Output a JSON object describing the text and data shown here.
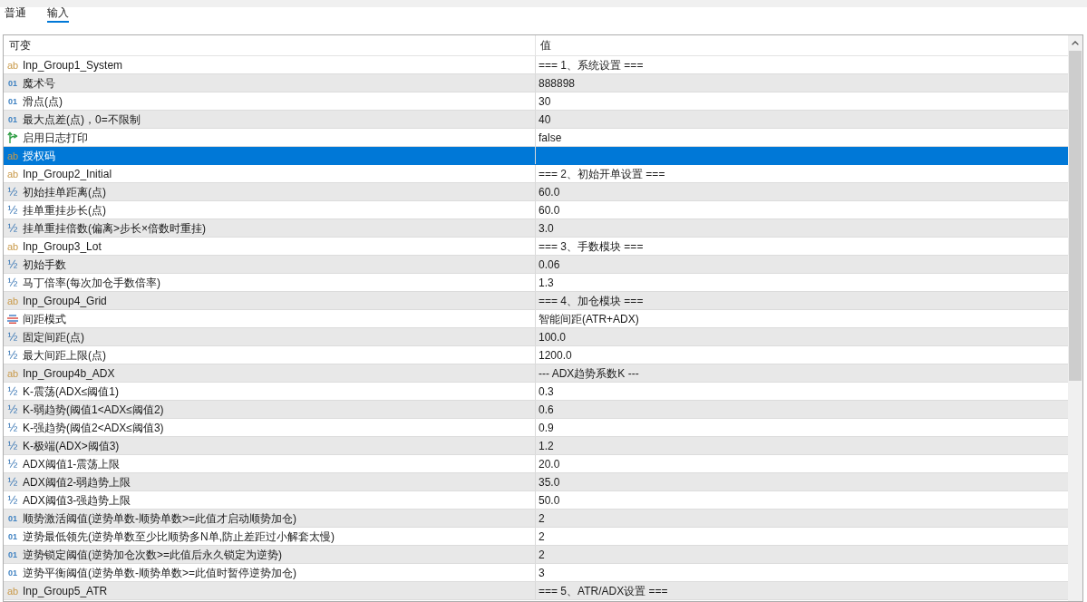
{
  "tabs": [
    {
      "label": "普通",
      "selected": false
    },
    {
      "label": "输入",
      "selected": true
    }
  ],
  "table": {
    "columns": [
      "可变",
      "值"
    ],
    "rows": [
      {
        "kind": "string",
        "type_icon": "ab",
        "name": "Inp_Group1_System",
        "value": "=== 1、系统设置 ===",
        "selected": false
      },
      {
        "kind": "integer",
        "type_icon": "01",
        "name": "魔术号",
        "value": "888898",
        "selected": false
      },
      {
        "kind": "integer",
        "type_icon": "01",
        "name": "滑点(点)",
        "value": "30",
        "selected": false
      },
      {
        "kind": "integer",
        "type_icon": "01",
        "name": "最大点差(点)，0=不限制",
        "value": "40",
        "selected": false
      },
      {
        "kind": "bool",
        "name": "启用日志打印",
        "value": "false",
        "selected": false
      },
      {
        "kind": "string",
        "type_icon": "ab",
        "name": "授权码",
        "selected": true
      },
      {
        "kind": "string",
        "type_icon": "ab",
        "name": "Inp_Group2_Initial",
        "value": "=== 2、初始开单设置 ===",
        "selected": false
      },
      {
        "kind": "double",
        "type_icon": "½",
        "name": "初始挂单距离(点)",
        "value": "60.0",
        "selected": false
      },
      {
        "kind": "double",
        "type_icon": "½",
        "name": "挂单重挂步长(点)",
        "value": "60.0",
        "selected": false
      },
      {
        "kind": "double",
        "type_icon": "½",
        "name": "挂单重挂倍数(偏离>步长×倍数时重挂)",
        "value": "3.0",
        "selected": false
      },
      {
        "kind": "string",
        "type_icon": "ab",
        "name": "Inp_Group3_Lot",
        "value": "=== 3、手数模块 ===",
        "selected": false
      },
      {
        "kind": "double",
        "type_icon": "½",
        "name": "初始手数",
        "value": "0.06",
        "selected": false
      },
      {
        "kind": "double",
        "type_icon": "½",
        "name": "马丁倍率(每次加仓手数倍率)",
        "value": "1.3",
        "selected": false
      },
      {
        "kind": "string",
        "type_icon": "ab",
        "name": "Inp_Group4_Grid",
        "value": "=== 4、加仓模块 ===",
        "selected": false
      },
      {
        "kind": "enum",
        "name": "间距模式",
        "value": "智能间距(ATR+ADX)",
        "selected": false
      },
      {
        "kind": "double",
        "type_icon": "½",
        "name": "固定间距(点)",
        "value": "100.0",
        "selected": false
      },
      {
        "kind": "double",
        "type_icon": "½",
        "name": "最大间距上限(点)",
        "value": "1200.0",
        "selected": false
      },
      {
        "kind": "string",
        "type_icon": "ab",
        "name": "Inp_Group4b_ADX",
        "value": "--- ADX趋势系数K ---",
        "selected": false
      },
      {
        "kind": "double",
        "type_icon": "½",
        "name": "K-震荡(ADX≤阈值1)",
        "value": "0.3",
        "selected": false
      },
      {
        "kind": "double",
        "type_icon": "½",
        "name": "K-弱趋势(阈值1<ADX≤阈值2)",
        "value": "0.6",
        "selected": false
      },
      {
        "kind": "double",
        "type_icon": "½",
        "name": "K-强趋势(阈值2<ADX≤阈值3)",
        "value": "0.9",
        "selected": false
      },
      {
        "kind": "double",
        "type_icon": "½",
        "name": "K-极端(ADX>阈值3)",
        "value": "1.2",
        "selected": false
      },
      {
        "kind": "double",
        "type_icon": "½",
        "name": "ADX阈值1-震荡上限",
        "value": "20.0",
        "selected": false
      },
      {
        "kind": "double",
        "type_icon": "½",
        "name": "ADX阈值2-弱趋势上限",
        "value": "35.0",
        "selected": false
      },
      {
        "kind": "double",
        "type_icon": "½",
        "name": "ADX阈值3-强趋势上限",
        "value": "50.0",
        "selected": false
      },
      {
        "kind": "integer",
        "type_icon": "01",
        "name": "顺势激活阈值(逆势单数-顺势单数>=此值才启动顺势加仓)",
        "value": "2",
        "selected": false
      },
      {
        "kind": "integer",
        "type_icon": "01",
        "name": "逆势最低领先(逆势单数至少比顺势多N单,防止差距过小解套太慢)",
        "value": "2",
        "selected": false
      },
      {
        "kind": "integer",
        "type_icon": "01",
        "name": "逆势锁定阈值(逆势加仓次数>=此值后永久锁定为逆势)",
        "value": "2",
        "selected": false
      },
      {
        "kind": "integer",
        "type_icon": "01",
        "name": "逆势平衡阈值(逆势单数-顺势单数>=此值时暂停逆势加仓)",
        "value": "3",
        "selected": false
      },
      {
        "kind": "string",
        "type_icon": "ab",
        "name": "Inp_Group5_ATR",
        "value": "=== 5、ATR/ADX设置 ===",
        "selected": false
      }
    ]
  }
}
